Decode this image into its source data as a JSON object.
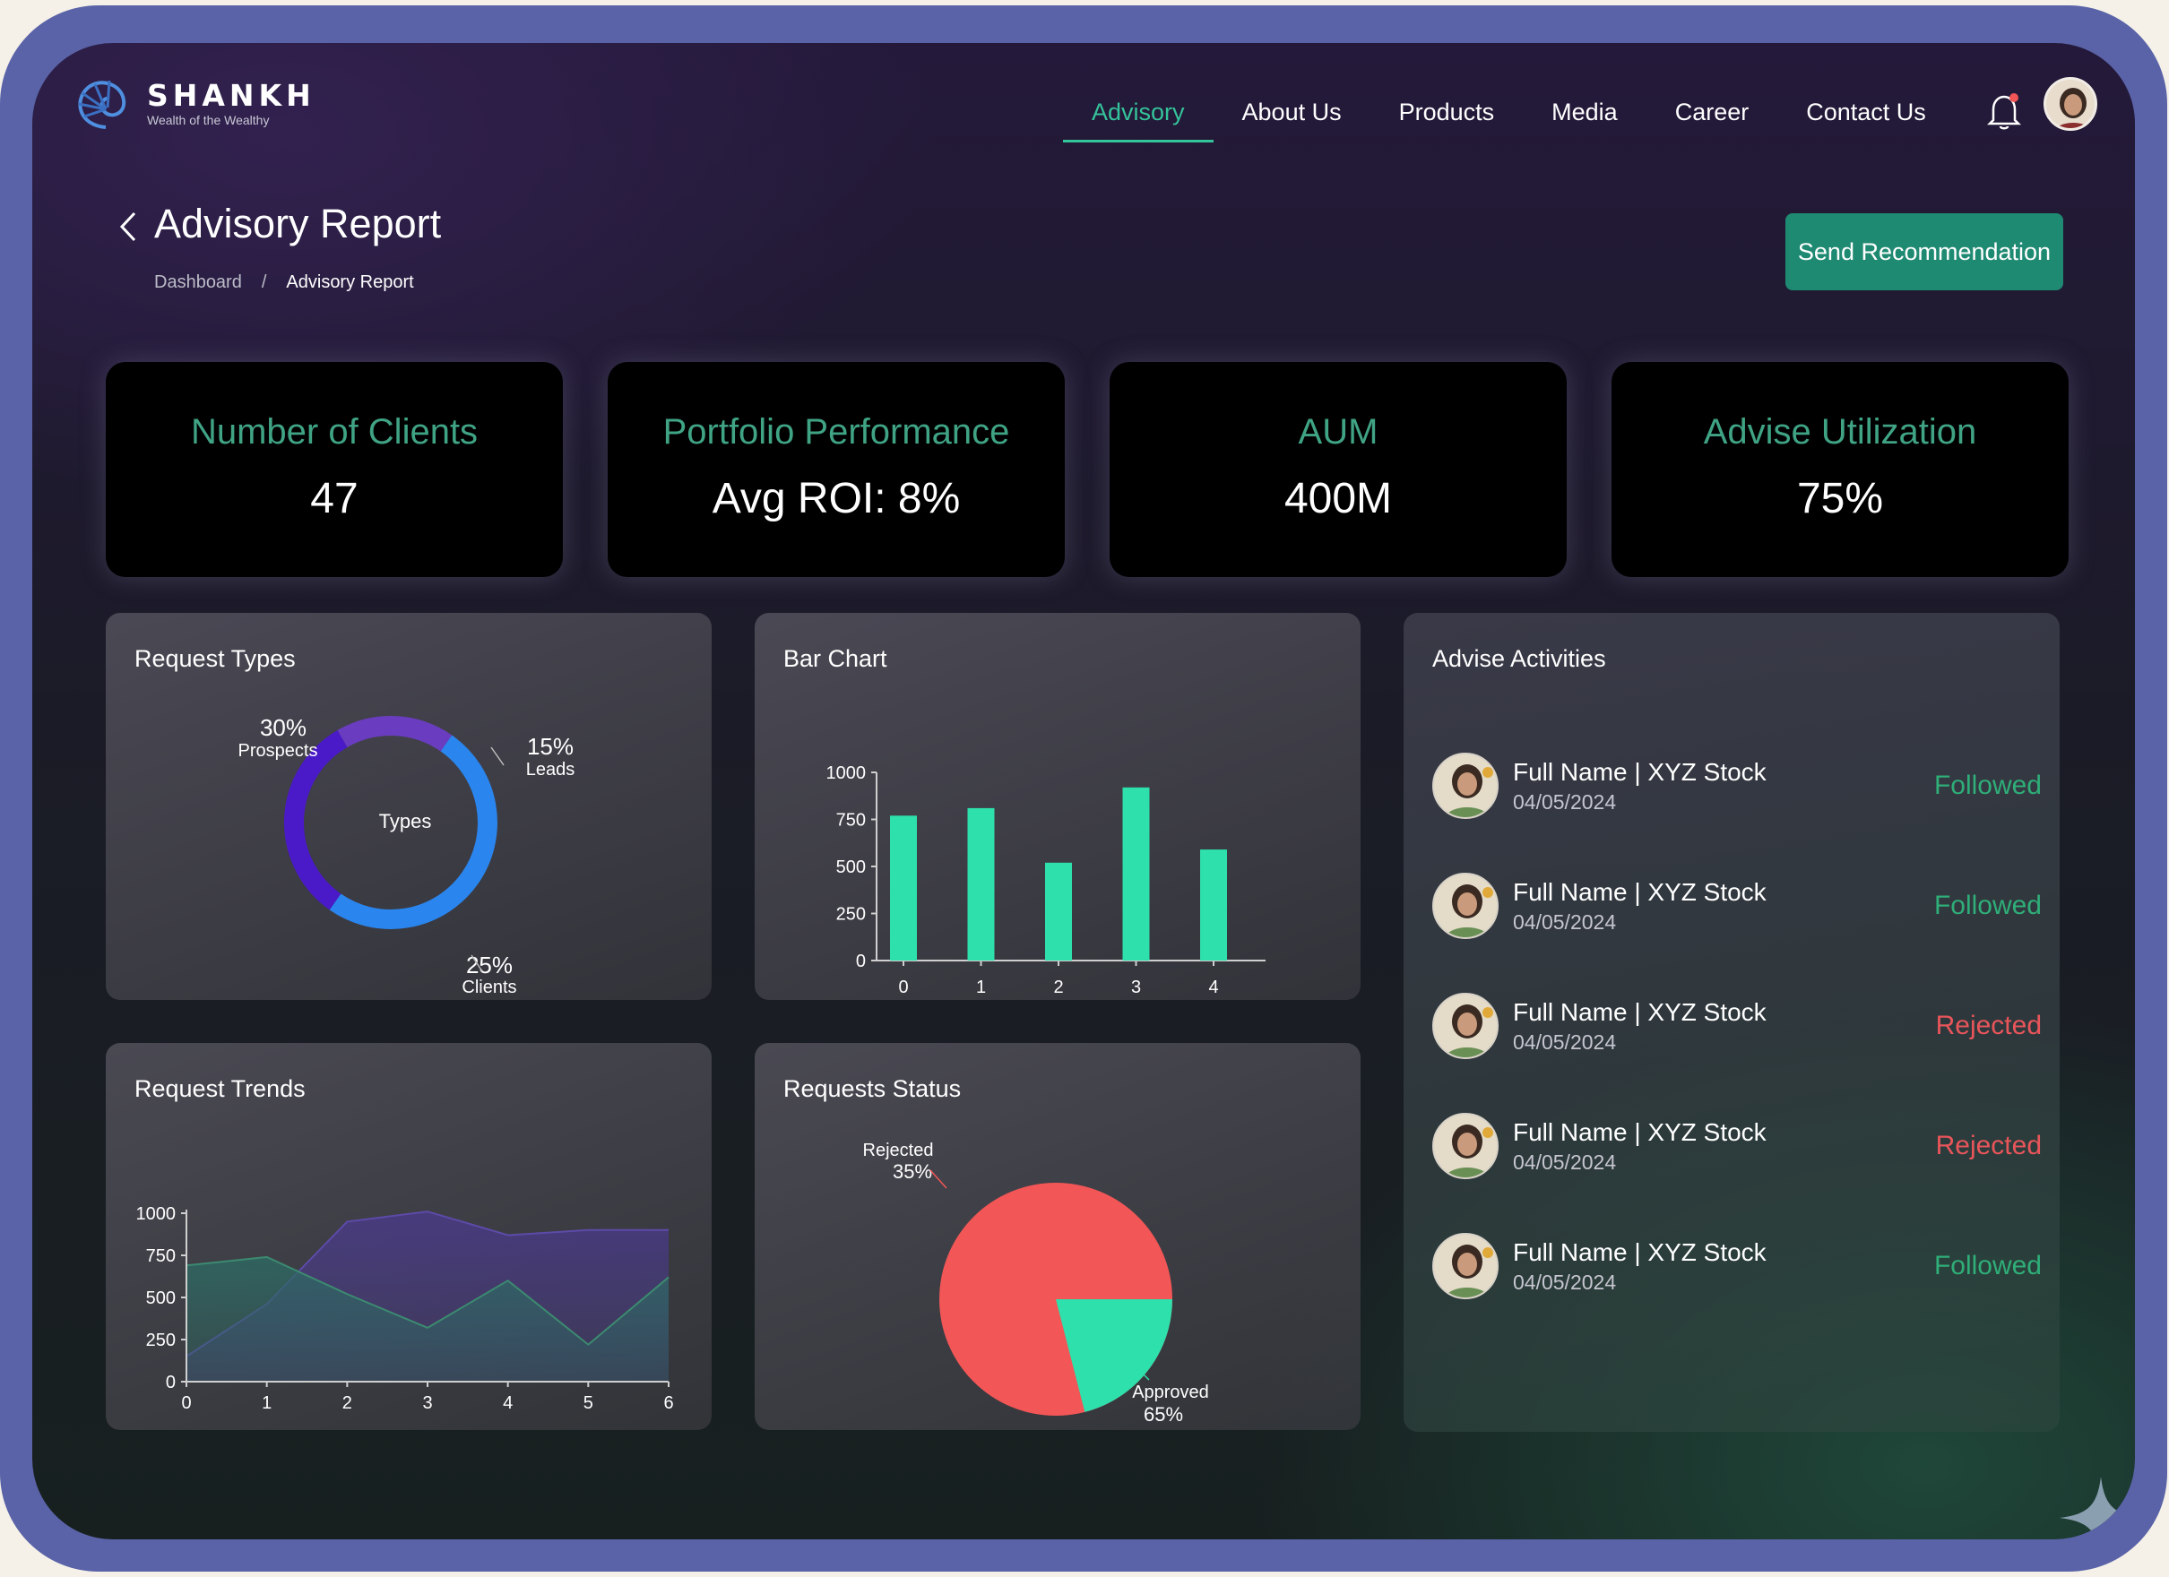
{
  "brand": {
    "name": "SHANKH",
    "tagline": "Wealth of the Wealthy"
  },
  "nav": {
    "items": [
      {
        "label": "Advisory",
        "active": true
      },
      {
        "label": "About Us"
      },
      {
        "label": "Products"
      },
      {
        "label": "Media"
      },
      {
        "label": "Career"
      },
      {
        "label": "Contact Us"
      }
    ]
  },
  "header": {
    "title": "Advisory Report",
    "breadcrumb": [
      "Dashboard",
      "/",
      "Advisory Report"
    ],
    "action_label": "Send Recommendation"
  },
  "kpis": [
    {
      "label": "Number of Clients",
      "value": "47"
    },
    {
      "label": "Portfolio Performance",
      "value": "Avg ROI: 8%"
    },
    {
      "label": "AUM",
      "value": "400M"
    },
    {
      "label": "Advise Utilization",
      "value": "75%"
    }
  ],
  "panels": {
    "request_types": "Request Types",
    "bar_chart": "Bar Chart",
    "request_trends": "Request Trends",
    "requests_status": "Requests Status",
    "advise_activities": "Advise Activities"
  },
  "chart_data": [
    {
      "type": "pie",
      "title": "Request Types",
      "center_label": "Types",
      "slices": [
        {
          "label": "Prospects",
          "percent_label": "30%",
          "value": 30,
          "color": "#4a19c8"
        },
        {
          "label": "Leads",
          "percent_label": "15%",
          "value": 15,
          "color": "#6a3dc0"
        },
        {
          "label": "Clients",
          "percent_label": "25%",
          "value": 25,
          "color": "#2a86ee"
        }
      ],
      "ring_colors": [
        "#4a19c8",
        "#6a3dc0",
        "#2a86ee"
      ]
    },
    {
      "type": "bar",
      "title": "Bar Chart",
      "categories": [
        "0",
        "1",
        "2",
        "3",
        "4"
      ],
      "values": [
        770,
        810,
        520,
        920,
        590
      ],
      "yticks": [
        "0",
        "250",
        "500",
        "750",
        "1000"
      ],
      "ylim": [
        0,
        1000
      ],
      "color": "#2ee0ac"
    },
    {
      "type": "area",
      "title": "Request Trends",
      "x": [
        0,
        1,
        2,
        3,
        4,
        5,
        6
      ],
      "xticks": [
        "0",
        "1",
        "2",
        "3",
        "4",
        "5",
        "6"
      ],
      "yticks": [
        "0",
        "250",
        "500",
        "750",
        "1000"
      ],
      "ylim": [
        0,
        1000
      ],
      "series": [
        {
          "values": [
            150,
            460,
            950,
            1010,
            870,
            900,
            900
          ],
          "color": "#4a3a8a"
        },
        {
          "values": [
            690,
            740,
            520,
            320,
            600,
            220,
            620
          ],
          "color": "#2d6a63"
        }
      ]
    },
    {
      "type": "pie",
      "title": "Requests Status",
      "slices": [
        {
          "label": "Rejected",
          "percent_label": "35%",
          "value": 35,
          "color": "#f25656"
        },
        {
          "label": "Approved",
          "percent_label": "65%",
          "value": 65,
          "color": "#2ee0ac"
        }
      ],
      "approved_sweep": 0.21
    }
  ],
  "activities": [
    {
      "name": "Full Name | XYZ Stock",
      "date": "04/05/2024",
      "status": "Followed"
    },
    {
      "name": "Full Name | XYZ Stock",
      "date": "04/05/2024",
      "status": "Followed"
    },
    {
      "name": "Full Name | XYZ Stock",
      "date": "04/05/2024",
      "status": "Rejected"
    },
    {
      "name": "Full Name | XYZ Stock",
      "date": "04/05/2024",
      "status": "Rejected"
    },
    {
      "name": "Full Name | XYZ Stock",
      "date": "04/05/2024",
      "status": "Followed"
    }
  ],
  "colors": {
    "accent": "#34c39a",
    "button": "#1f8a72",
    "followed": "#2fae78",
    "rejected": "#e8555a"
  }
}
